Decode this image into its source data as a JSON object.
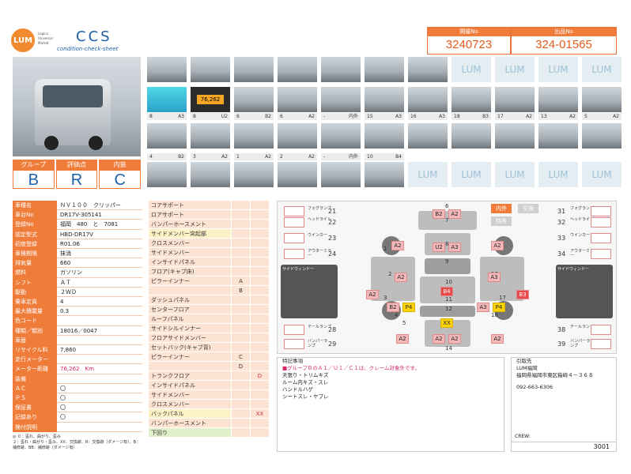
{
  "header": {
    "logo": "LUM",
    "logo_sub": "Logico Universal Market",
    "title": "CCS",
    "subtitle": "condition-check-sheet",
    "lot_label": "開催No",
    "lot_value": "3240723",
    "exhibit_label": "出品No",
    "exhibit_value": "324-01565"
  },
  "photos": {
    "lum_text": "LUM",
    "row1_labels": [
      {
        "n": "8",
        "g": "A3"
      },
      {
        "n": "8",
        "g": "U2"
      },
      {
        "n": "6",
        "g": "B2"
      },
      {
        "n": "6",
        "g": "A2"
      },
      {
        "n": "-",
        "g": "内外"
      },
      {
        "n": "15",
        "g": "A3"
      },
      {
        "n": "16",
        "g": "A3"
      },
      {
        "n": "18",
        "g": "B3"
      },
      {
        "n": "17",
        "g": "A2"
      },
      {
        "n": "13",
        "g": "A2"
      },
      {
        "n": "5",
        "g": "A2"
      }
    ],
    "row2_labels": [
      {
        "n": "4",
        "g": "B2"
      },
      {
        "n": "3",
        "g": "A2"
      },
      {
        "n": "1",
        "g": "A2"
      },
      {
        "n": "2",
        "g": "A2"
      },
      {
        "n": "-",
        "g": "内外"
      },
      {
        "n": "10",
        "g": "B4"
      }
    ],
    "odometer": "76,262"
  },
  "grades": {
    "labels": [
      "グループ",
      "評価点",
      "内装"
    ],
    "values": [
      "B",
      "R",
      "C"
    ]
  },
  "specs": [
    {
      "k": "車種名",
      "v": "ＮＶ１００　クリッパー"
    },
    {
      "k": "車台No",
      "v": "DR17V-305141"
    },
    {
      "k": "登録No",
      "v": "福岡　480　と　7081"
    },
    {
      "k": "認定型式",
      "v": "HBD-DR17V"
    },
    {
      "k": "初度登録",
      "v": "R01.06"
    },
    {
      "k": "車検期限",
      "v": "抹消"
    },
    {
      "k": "排気量",
      "v": "660"
    },
    {
      "k": "燃料",
      "v": "ガソリン"
    },
    {
      "k": "シフト",
      "v": "ＡＴ"
    },
    {
      "k": "駆動",
      "v": "２ＷＤ"
    },
    {
      "k": "乗車定員",
      "v": "4"
    },
    {
      "k": "最大積載量",
      "v": "0.3"
    },
    {
      "k": "色コード",
      "v": ""
    },
    {
      "k": "種類／類別",
      "v": "18016／0047"
    },
    {
      "k": "車歴",
      "v": ""
    },
    {
      "k": "リサイクル料",
      "v": "7,860"
    },
    {
      "k": "走行メーター",
      "v": ""
    },
    {
      "k": "メーター距離",
      "v": "76,262　Km"
    },
    {
      "k": "装備",
      "v": ""
    },
    {
      "k": "ＡＣ",
      "v": "〇"
    },
    {
      "k": "ＰＳ",
      "v": "〇"
    },
    {
      "k": "保証書",
      "v": "〇"
    },
    {
      "k": "記録あり",
      "v": "〇"
    },
    {
      "k": "検付説明",
      "v": ""
    }
  ],
  "legend": [
    "◎ ０：歪れ、曲がり、歪み",
    "２：歪れ・曲がり・歪み、XX：交換跡、R：交換跡（ダメージ有）、B：補修跡、BB：補修跡（ダメージ有）"
  ],
  "parts": [
    {
      "k": "コアサポート",
      "s": "",
      "c": ""
    },
    {
      "k": "ロアサポート",
      "s": "",
      "c": ""
    },
    {
      "k": "バンパーホースメント",
      "s": "",
      "c": ""
    },
    {
      "k": "サイドメンバー突起部",
      "s": "",
      "c": "",
      "t": "y"
    },
    {
      "k": "クロスメンバー",
      "s": "",
      "c": ""
    },
    {
      "k": "サイドメンバー",
      "s": "",
      "c": ""
    },
    {
      "k": "インサイドパネル",
      "s": "",
      "c": ""
    },
    {
      "k": "フロア(キャブ床)",
      "s": "",
      "c": ""
    },
    {
      "k": "ピラーインナー",
      "s": "A",
      "c": ""
    },
    {
      "k": "",
      "s": "B",
      "c": ""
    },
    {
      "k": "ダッシュパネル",
      "s": "",
      "c": ""
    },
    {
      "k": "センターフロア",
      "s": "",
      "c": ""
    },
    {
      "k": "ルーフパネル",
      "s": "",
      "c": ""
    },
    {
      "k": "サイドシルインナー",
      "s": "",
      "c": ""
    },
    {
      "k": "フロアサイドメンバー",
      "s": "",
      "c": ""
    },
    {
      "k": "セットバック(キャブ背)",
      "s": "",
      "c": ""
    },
    {
      "k": "ピラーインナー",
      "s": "C",
      "c": ""
    },
    {
      "k": "",
      "s": "D",
      "c": ""
    },
    {
      "k": "トランクフロア",
      "s": "",
      "c": "D"
    },
    {
      "k": "インサイドパネル",
      "s": "",
      "c": ""
    },
    {
      "k": "サイドメンバー",
      "s": "",
      "c": ""
    },
    {
      "k": "クロスメンバー",
      "s": "",
      "c": ""
    },
    {
      "k": "バックパネル",
      "s": "",
      "c": "XX",
      "t": "y"
    },
    {
      "k": "バンパーホースメント",
      "s": "",
      "c": ""
    },
    {
      "k": "下回り",
      "s": "",
      "c": "",
      "t": "g"
    }
  ],
  "map": {
    "tab_active": "内外",
    "tab_inactive": "交換",
    "tab_sub": "特殊",
    "left_labels": [
      {
        "n": "21",
        "t": "フォグランプ"
      },
      {
        "n": "22",
        "t": "ヘッドライト"
      },
      {
        "n": "23",
        "t": "ウインカー"
      },
      {
        "n": "24",
        "t": "アウターミラー"
      },
      {
        "n": "25",
        "t": "フロント"
      },
      {
        "n": "26",
        "t": "リア"
      },
      {
        "n": "27",
        "t": "荷室"
      },
      {
        "n": "28",
        "t": "テールランプ"
      },
      {
        "n": "29",
        "t": "バンパーランプ"
      }
    ],
    "right_labels": [
      {
        "n": "31",
        "t": "フォグランプ"
      },
      {
        "n": "32",
        "t": "ヘッドライト"
      },
      {
        "n": "33",
        "t": "ウインカー"
      },
      {
        "n": "34",
        "t": "アウターミラー"
      },
      {
        "n": "35",
        "t": "フロント"
      },
      {
        "n": "36",
        "t": "リア"
      },
      {
        "n": "37",
        "t": "荷室"
      },
      {
        "n": "38",
        "t": "テールランプ"
      },
      {
        "n": "39",
        "t": "バンパーランプ"
      }
    ],
    "window_label": "サイドウィンドー",
    "numbers": [
      "6",
      "7",
      "8",
      "9",
      "10",
      "11",
      "12",
      "13",
      "14",
      "1",
      "2",
      "3",
      "4",
      "5",
      "15",
      "16",
      "17",
      "18"
    ],
    "damage": [
      "B2",
      "A2",
      "A2",
      "U2",
      "A3",
      "A2",
      "A2",
      "A3",
      "A2",
      "B4",
      "A2",
      "B3",
      "B2",
      "P4",
      "A3",
      "P4",
      "XX",
      "A2",
      "A2",
      "A2",
      "A2"
    ]
  },
  "notes": {
    "title": "特記事項",
    "items": [
      "■グループＢのＡ１／Ｕ１／Ｃ１は、クレーム対象外です。",
      "天張り・トリムキズ",
      "ルーム内キズ・スレ",
      "ハンドルハゲ",
      "シートスレ・ヤブレ"
    ]
  },
  "seller": {
    "title": "引取先",
    "name": "LUM福岡",
    "address": "福岡県福岡市東区箱崎４－３６８",
    "tel": "092-663-6306",
    "crew_label": "CREW:",
    "crew_value": "3001"
  }
}
